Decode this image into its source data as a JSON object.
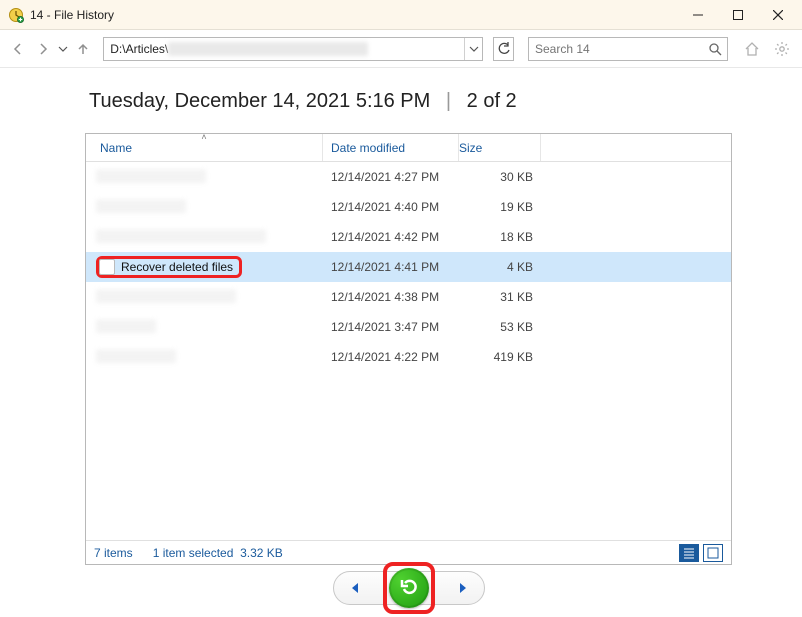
{
  "title": "14 - File History",
  "toolbar": {
    "path_visible": "D:\\Articles\\",
    "search_placeholder": "Search 14"
  },
  "heading": {
    "datetime": "Tuesday, December 14, 2021 5:16 PM",
    "position": "2 of 2"
  },
  "columns": {
    "name": "Name",
    "date": "Date modified",
    "size": "Size"
  },
  "rows": [
    {
      "name": "",
      "date": "12/14/2021 4:27 PM",
      "size": "30 KB",
      "selected": false,
      "blurred": true,
      "icon": "grey",
      "name_width": 110
    },
    {
      "name": "",
      "date": "12/14/2021 4:40 PM",
      "size": "19 KB",
      "selected": false,
      "blurred": true,
      "icon": "grey",
      "name_width": 90
    },
    {
      "name": "",
      "date": "12/14/2021 4:42 PM",
      "size": "18 KB",
      "selected": false,
      "blurred": true,
      "icon": "blue",
      "name_width": 170
    },
    {
      "name": "Recover deleted files",
      "date": "12/14/2021 4:41 PM",
      "size": "4 KB",
      "selected": true,
      "blurred": false,
      "icon": "doc",
      "name_width": 0
    },
    {
      "name": "",
      "date": "12/14/2021 4:38 PM",
      "size": "31 KB",
      "selected": false,
      "blurred": true,
      "icon": "blue",
      "name_width": 140
    },
    {
      "name": "",
      "date": "12/14/2021 3:47 PM",
      "size": "53 KB",
      "selected": false,
      "blurred": true,
      "icon": "grey",
      "name_width": 60
    },
    {
      "name": "",
      "date": "12/14/2021 4:22 PM",
      "size": "419 KB",
      "selected": false,
      "blurred": true,
      "icon": "grey",
      "name_width": 80
    }
  ],
  "status": {
    "items": "7 items",
    "selected": "1 item selected",
    "size": "3.32 KB"
  },
  "icons": {
    "back": "back-icon",
    "forward": "forward-icon",
    "up": "up-icon",
    "refresh": "refresh-icon",
    "search": "search-icon",
    "home": "home-icon",
    "gear": "gear-icon",
    "minimize": "minimize-icon",
    "maximize": "maximize-icon",
    "close": "close-icon",
    "prev": "previous-version-icon",
    "next": "next-version-icon",
    "restore": "restore-icon",
    "details_view": "details-view-icon",
    "large_view": "large-icons-view-icon"
  }
}
